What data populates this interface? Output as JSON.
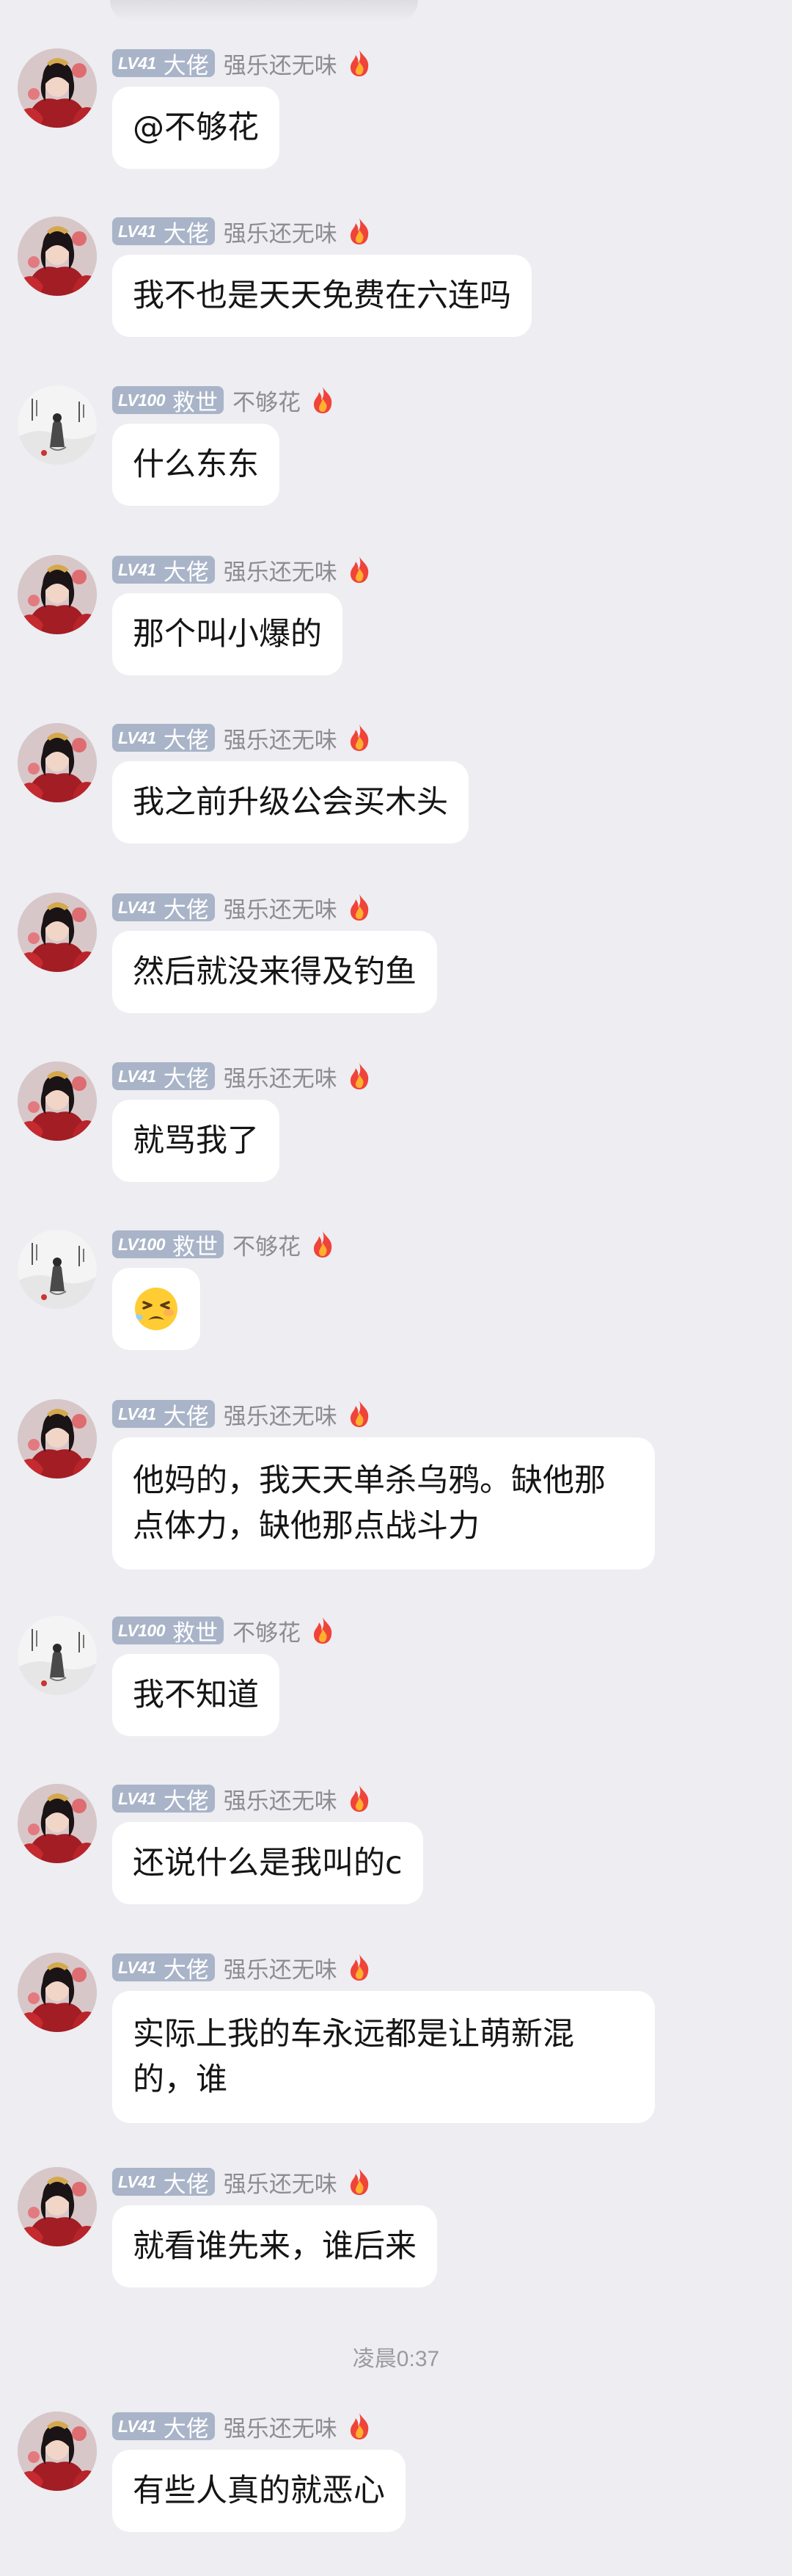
{
  "messages": [
    {
      "sender": "a",
      "level": "LV41",
      "title": "大佬",
      "name": "强乐还无味",
      "text": "@不够花"
    },
    {
      "sender": "a",
      "level": "LV41",
      "title": "大佬",
      "name": "强乐还无味",
      "text": "我不也是天天免费在六连吗"
    },
    {
      "sender": "b",
      "level": "LV100",
      "title": "救世",
      "name": "不够花",
      "text": "什么东东"
    },
    {
      "sender": "a",
      "level": "LV41",
      "title": "大佬",
      "name": "强乐还无味",
      "text": "那个叫小爆的"
    },
    {
      "sender": "a",
      "level": "LV41",
      "title": "大佬",
      "name": "强乐还无味",
      "text": "我之前升级公会买木头"
    },
    {
      "sender": "a",
      "level": "LV41",
      "title": "大佬",
      "name": "强乐还无味",
      "text": "然后就没来得及钓鱼"
    },
    {
      "sender": "a",
      "level": "LV41",
      "title": "大佬",
      "name": "强乐还无味",
      "text": "就骂我了"
    },
    {
      "sender": "b",
      "level": "LV100",
      "title": "救世",
      "name": "不够花",
      "emoji": "tired-face-emoji"
    },
    {
      "sender": "a",
      "level": "LV41",
      "title": "大佬",
      "name": "强乐还无味",
      "text": "他妈的，我天天单杀乌鸦。缺他那点体力，缺他那点战斗力"
    },
    {
      "sender": "b",
      "level": "LV100",
      "title": "救世",
      "name": "不够花",
      "text": "我不知道"
    },
    {
      "sender": "a",
      "level": "LV41",
      "title": "大佬",
      "name": "强乐还无味",
      "text": "还说什么是我叫的c"
    },
    {
      "sender": "a",
      "level": "LV41",
      "title": "大佬",
      "name": "强乐还无味",
      "text": "实际上我的车永远都是让萌新混的，谁"
    },
    {
      "sender": "a",
      "level": "LV41",
      "title": "大佬",
      "name": "强乐还无味",
      "text": "就看谁先来，谁后来"
    },
    {
      "sender": "a",
      "level": "LV41",
      "title": "大佬",
      "name": "强乐还无味",
      "text": "有些人真的就恶心"
    }
  ],
  "timestamp": "凌晨0:37",
  "colors": {
    "background": "#ededf2",
    "bubble": "#ffffff",
    "badge": "#a9b4c8",
    "nickname": "#8c8c92",
    "timestamp": "#9a9aa0"
  },
  "icons": {
    "fire": "fire-icon",
    "avatar_a": "red-costume-character-avatar",
    "avatar_b": "ink-painting-avatar"
  }
}
